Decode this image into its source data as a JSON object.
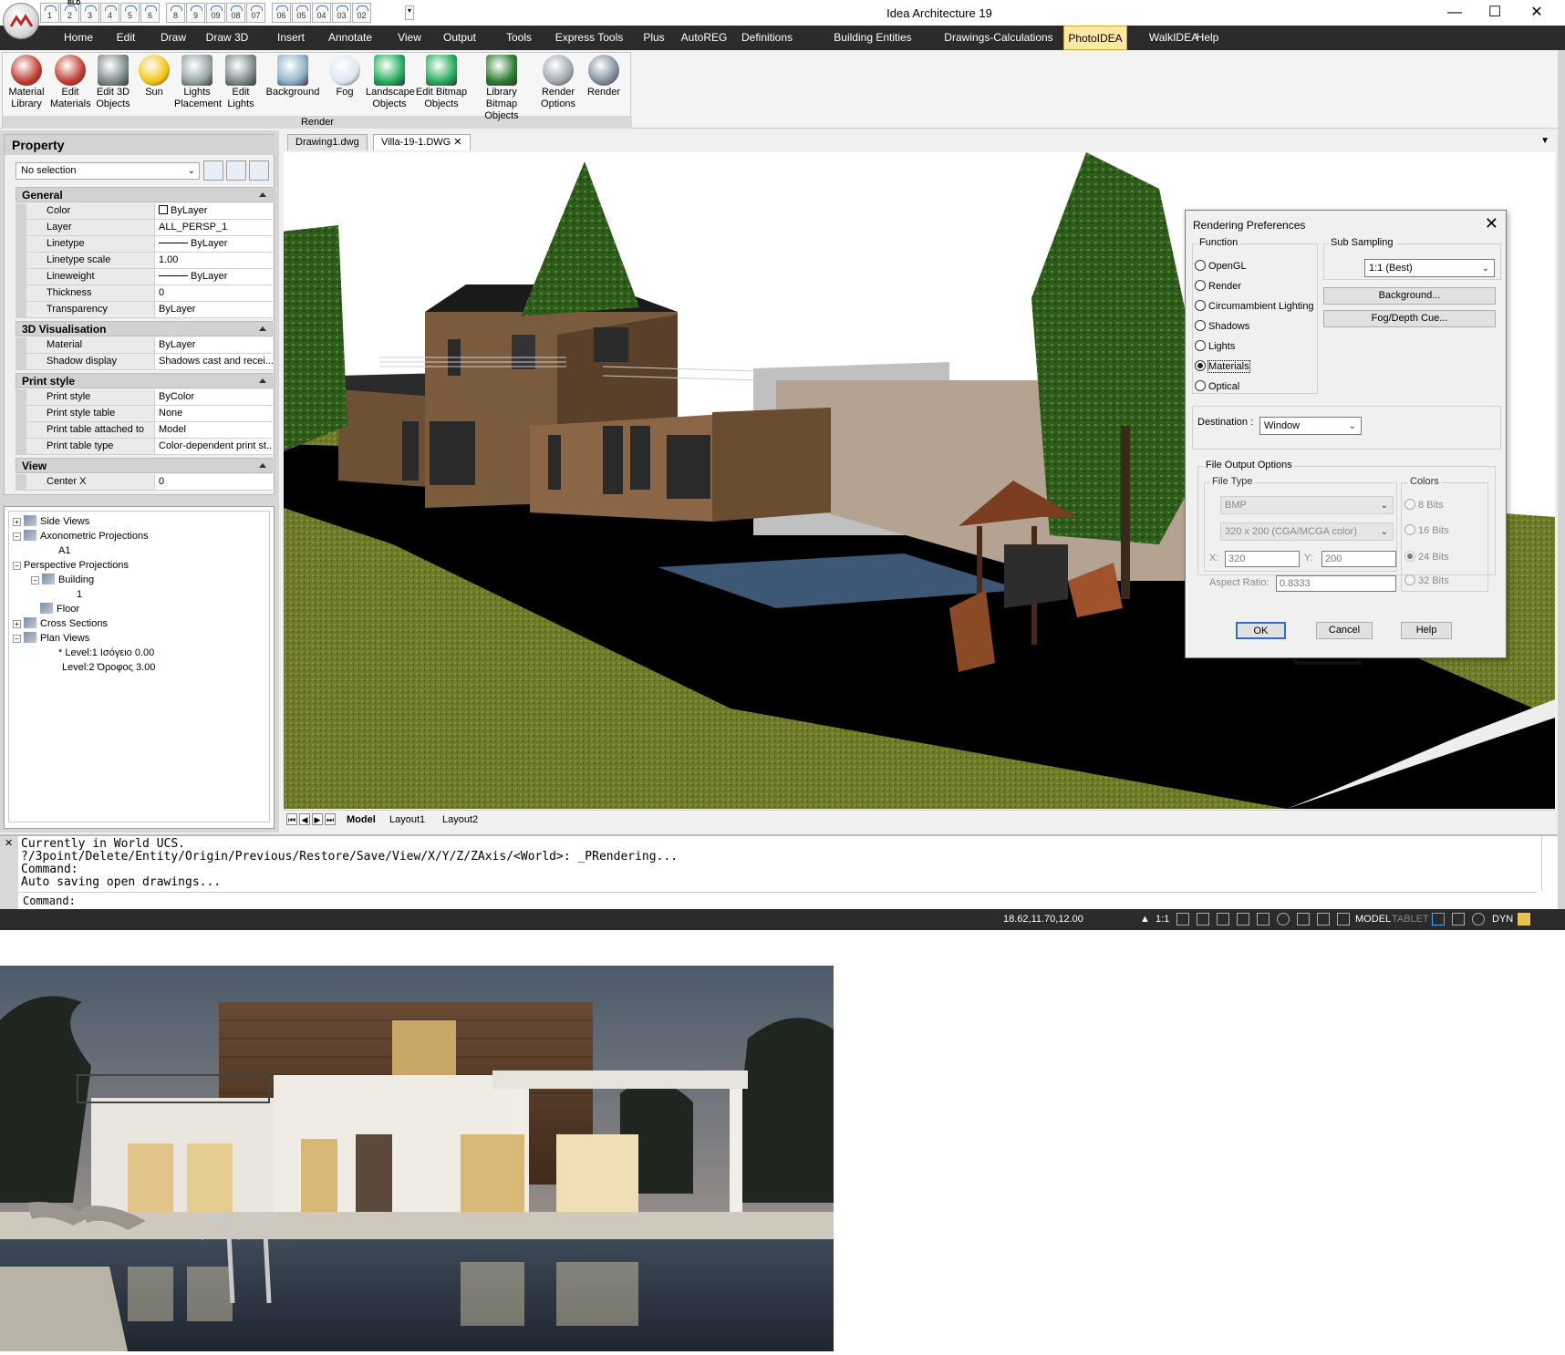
{
  "app": {
    "title": "Idea Architecture 19",
    "quick_access": [
      "1",
      "2",
      "3",
      "4",
      "5",
      "6",
      "",
      "8",
      "9",
      "09",
      "08",
      "07",
      "",
      "06",
      "05",
      "04",
      "03",
      "02"
    ],
    "quick_access_top_label": "BLD"
  },
  "menu": {
    "items": [
      "Home",
      "Edit",
      "Draw",
      "Draw 3D",
      "Insert",
      "Annotate",
      "View",
      "Output",
      "Tools",
      "Express Tools",
      "Plus",
      "AutoREG",
      "Definitions",
      "Building Entities",
      "Drawings-Calculations",
      "PhotoIDEA",
      "WalkIDEA",
      "Help"
    ],
    "active": "PhotoIDEA"
  },
  "ribbon": {
    "group_label": "Render",
    "buttons": [
      {
        "label": "Material\nLibrary",
        "icon": "material-library-icon"
      },
      {
        "label": "Edit\nMaterials",
        "icon": "edit-materials-icon"
      },
      {
        "label": "Edit 3D\nObjects",
        "icon": "edit-3d-objects-icon"
      },
      {
        "label": "Sun",
        "icon": "sun-icon"
      },
      {
        "label": "Lights\nPlacement",
        "icon": "lights-placement-icon"
      },
      {
        "label": "Edit\nLights",
        "icon": "edit-lights-icon"
      },
      {
        "label": "Background",
        "icon": "background-icon"
      },
      {
        "label": "Fog",
        "icon": "fog-icon"
      },
      {
        "label": "Landscape\nObjects",
        "icon": "landscape-objects-icon"
      },
      {
        "label": "Edit Bitmap\nObjects",
        "icon": "edit-bitmap-objects-icon"
      },
      {
        "label": "Library Bitmap\nObjects",
        "icon": "library-bitmap-objects-icon"
      },
      {
        "label": "Render\nOptions",
        "icon": "render-options-icon"
      },
      {
        "label": "Render",
        "icon": "render-icon"
      }
    ]
  },
  "property": {
    "title": "Property",
    "selection": "No selection",
    "sections": [
      {
        "name": "General",
        "rows": [
          {
            "key": "Color",
            "value": "ByLayer"
          },
          {
            "key": "Layer",
            "value": "ALL_PERSP_1"
          },
          {
            "key": "Linetype",
            "value": "ByLayer"
          },
          {
            "key": "Linetype scale",
            "value": "1.00"
          },
          {
            "key": "Lineweight",
            "value": "ByLayer"
          },
          {
            "key": "Thickness",
            "value": "0"
          },
          {
            "key": "Transparency",
            "value": "ByLayer"
          }
        ]
      },
      {
        "name": "3D Visualisation",
        "rows": [
          {
            "key": "Material",
            "value": "ByLayer"
          },
          {
            "key": "Shadow display",
            "value": "Shadows cast and recei..."
          }
        ]
      },
      {
        "name": "Print style",
        "rows": [
          {
            "key": "Print style",
            "value": "ByColor"
          },
          {
            "key": "Print style table",
            "value": "None"
          },
          {
            "key": "Print table attached to",
            "value": "Model"
          },
          {
            "key": "Print table type",
            "value": "Color-dependent print st..."
          }
        ]
      },
      {
        "name": "View",
        "rows": [
          {
            "key": "Center X",
            "value": "0"
          }
        ]
      }
    ]
  },
  "tree": [
    {
      "label": "Side Views"
    },
    {
      "label": "Axonometric Projections"
    },
    {
      "label": "A1"
    },
    {
      "label": "Perspective Projections"
    },
    {
      "label": "Building"
    },
    {
      "label": "1"
    },
    {
      "label": "Floor"
    },
    {
      "label": "Cross Sections"
    },
    {
      "label": "Plan Views"
    },
    {
      "label": "* Level:1 Ισόγειο 0.00"
    },
    {
      "label": "Level:2 Όροφος 3.00"
    }
  ],
  "doc_tabs": [
    "Drawing1.dwg",
    "Villa-19-1.DWG"
  ],
  "layout_tabs": [
    "Model",
    "Layout1",
    "Layout2"
  ],
  "dialog": {
    "title": "Rendering Preferences",
    "function_label": "Function",
    "functions": [
      "OpenGL",
      "Render",
      "Circumambient Lighting",
      "Shadows",
      "Lights",
      "Materials",
      "Optical"
    ],
    "function_selected": "Materials",
    "sub_sampling_label": "Sub Sampling",
    "sub_sampling_value": "1:1 (Best)",
    "background_btn": "Background...",
    "fog_btn": "Fog/Depth Cue...",
    "destination_label": "Destination :",
    "destination_value": "Window",
    "file_output_label": "File Output Options",
    "file_type_label": "File Type",
    "file_type_value": "BMP",
    "resolution_value": "320 x 200 (CGA/MCGA color)",
    "x_label": "X:",
    "x_value": "320",
    "y_label": "Y:",
    "y_value": "200",
    "aspect_label": "Aspect Ratio:",
    "aspect_value": "0.8333",
    "colors_label": "Colors",
    "colors": [
      "8 Bits",
      "16 Bits",
      "24 Bits",
      "32 Bits"
    ],
    "colors_selected": "24 Bits",
    "ok": "OK",
    "cancel": "Cancel",
    "help": "Help"
  },
  "command": {
    "lines": [
      "Currently in World UCS.",
      "?/3point/Delete/Entity/Origin/Previous/Restore/Save/View/X/Y/Z/ZAxis/<World>: _PRendering...",
      "Command:",
      "Auto saving open drawings..."
    ],
    "prompt": "Command:"
  },
  "status": {
    "coords": "18.62,11.70,12.00",
    "scale": "1:1",
    "model": "MODEL",
    "tablet": "TABLET",
    "dyn": "DYN"
  }
}
